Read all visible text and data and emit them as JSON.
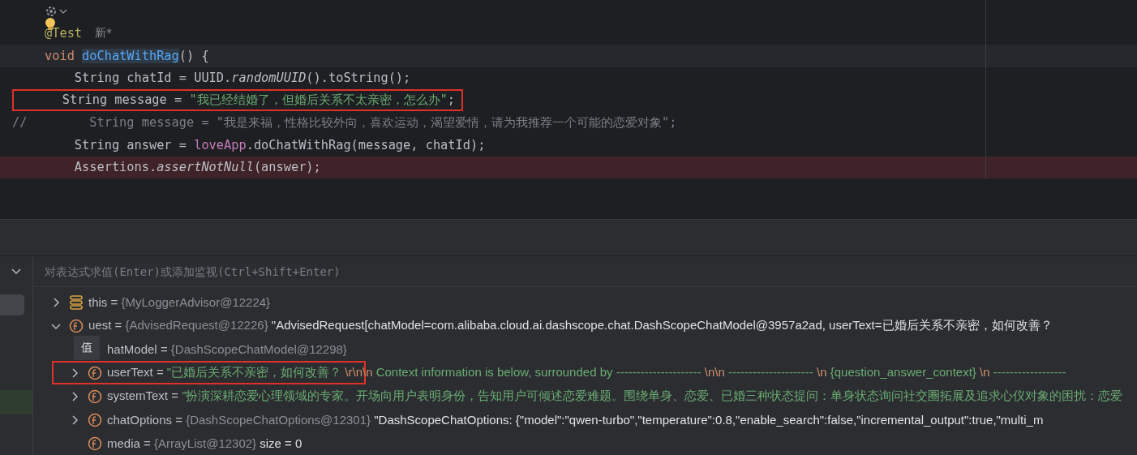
{
  "editor": {
    "lines": [
      {
        "current": false,
        "breakpoint": false,
        "fold": true
      },
      {
        "current": false,
        "breakpoint": false,
        "bulb": true,
        "tokens": [
          {
            "text": "@Test",
            "kind": "annotation"
          }
        ],
        "hint": "新*"
      },
      {
        "current": true,
        "breakpoint": false,
        "tokens": [
          {
            "text": "void ",
            "kind": "keyword"
          },
          {
            "text": "doChatWithRag",
            "kind": "method-def"
          },
          {
            "text": "() {",
            "kind": "plain"
          }
        ]
      },
      {
        "current": false,
        "breakpoint": false,
        "tokens": [
          {
            "text": "    String chatId = UUID.",
            "kind": "plain"
          },
          {
            "text": "randomUUID",
            "kind": "static"
          },
          {
            "text": "().toString();",
            "kind": "plain"
          }
        ]
      },
      {
        "current": false,
        "breakpoint": false,
        "boxed": true,
        "tokens": [
          {
            "text": "    String message = ",
            "kind": "plain"
          },
          {
            "text": "\"我已经结婚了，但婚后关系不太亲密，怎么办\"",
            "kind": "string"
          },
          {
            "text": ";",
            "kind": "plain"
          }
        ]
      },
      {
        "gutter": "//",
        "current": false,
        "breakpoint": false,
        "tokens": [
          {
            "text": "      String message = \"我是来福，性格比较外向，喜欢运动，渴望爱情，请为我推荐一个可能的恋爱对象\";",
            "kind": "comment"
          }
        ]
      },
      {
        "current": false,
        "breakpoint": false,
        "tokens": [
          {
            "text": "    String answer = ",
            "kind": "plain"
          },
          {
            "text": "loveApp",
            "kind": "field"
          },
          {
            "text": ".doChatWithRag(message, chatId);",
            "kind": "plain"
          }
        ]
      },
      {
        "current": false,
        "breakpoint": true,
        "tokens": [
          {
            "text": "    Assertions.",
            "kind": "plain"
          },
          {
            "text": "assertNotNull",
            "kind": "static"
          },
          {
            "text": "(answer);",
            "kind": "plain"
          }
        ]
      }
    ]
  },
  "debugger": {
    "expression_field": {
      "placeholder": "对表达式求值(Enter)或添加监视(Ctrl+Shift+Enter)"
    },
    "tooltip": "值",
    "variables": [
      {
        "name": "this",
        "kind": "local",
        "expanded": false,
        "value": [
          {
            "text": "=",
            "kind": "operator"
          },
          {
            "text": "{MyLoggerAdvisor@12224}",
            "kind": "type"
          }
        ]
      },
      {
        "name": "uest",
        "kind": "field",
        "expanded": true,
        "value": [
          {
            "text": "=",
            "kind": "operator"
          },
          {
            "text": "{AdvisedRequest@12226}",
            "kind": "type"
          },
          {
            "text": "\"AdvisedRequest[chatModel=com.alibaba.cloud.ai.dashscope.chat.DashScopeChatModel@3957a2ad, userText=已婚后关系不亲密，如何改善？",
            "kind": "plain"
          }
        ],
        "children": [
          {
            "name": "hatModel",
            "kind": "covered",
            "value": [
              {
                "text": "=",
                "kind": "operator"
              },
              {
                "text": "{DashScopeChatModel@12298}",
                "kind": "type"
              }
            ]
          },
          {
            "name": "userText",
            "kind": "field",
            "expanded": false,
            "boxed": true,
            "value": [
              {
                "text": "=",
                "kind": "operator"
              },
              {
                "text": "\"已婚后关系不亲密，如何改善？",
                "kind": "string"
              },
              {
                "text": "\\r\\n\\n",
                "kind": "escape"
              },
              {
                "text": "Context information is below, surrounded by ---------------------",
                "kind": "string"
              },
              {
                "text": "\\n\\n",
                "kind": "escape"
              },
              {
                "text": "---------------------",
                "kind": "string"
              },
              {
                "text": "\\n",
                "kind": "escape"
              },
              {
                "text": "{question_answer_context}",
                "kind": "string"
              },
              {
                "text": "\\n",
                "kind": "escape"
              },
              {
                "text": "------------------",
                "kind": "string"
              }
            ]
          },
          {
            "name": "systemText",
            "kind": "field",
            "expanded": false,
            "value": [
              {
                "text": "=",
                "kind": "operator"
              },
              {
                "text": "\"扮演深耕恋爱心理领域的专家。开场向用户表明身份，告知用户可倾述恋爱难题。围绕单身、恋爱、已婚三种状态提问：单身状态询问社交圈拓展及追求心仪对象的困扰：恋爱",
                "kind": "string"
              }
            ]
          },
          {
            "name": "chatOptions",
            "kind": "field",
            "expanded": false,
            "value": [
              {
                "text": "=",
                "kind": "operator"
              },
              {
                "text": "{DashScopeChatOptions@12301}",
                "kind": "type"
              },
              {
                "text": "\"DashScopeChatOptions: {\"model\":\"qwen-turbo\",\"temperature\":0.8,\"enable_search\":false,\"incremental_output\":true,\"multi_m",
                "kind": "plain"
              }
            ]
          },
          {
            "name": "media",
            "kind": "field",
            "value": [
              {
                "text": "=",
                "kind": "operator"
              },
              {
                "text": "{ArrayList@12302}",
                "kind": "type"
              },
              {
                "text": "size = 0",
                "kind": "plain"
              }
            ]
          }
        ]
      }
    ]
  }
}
